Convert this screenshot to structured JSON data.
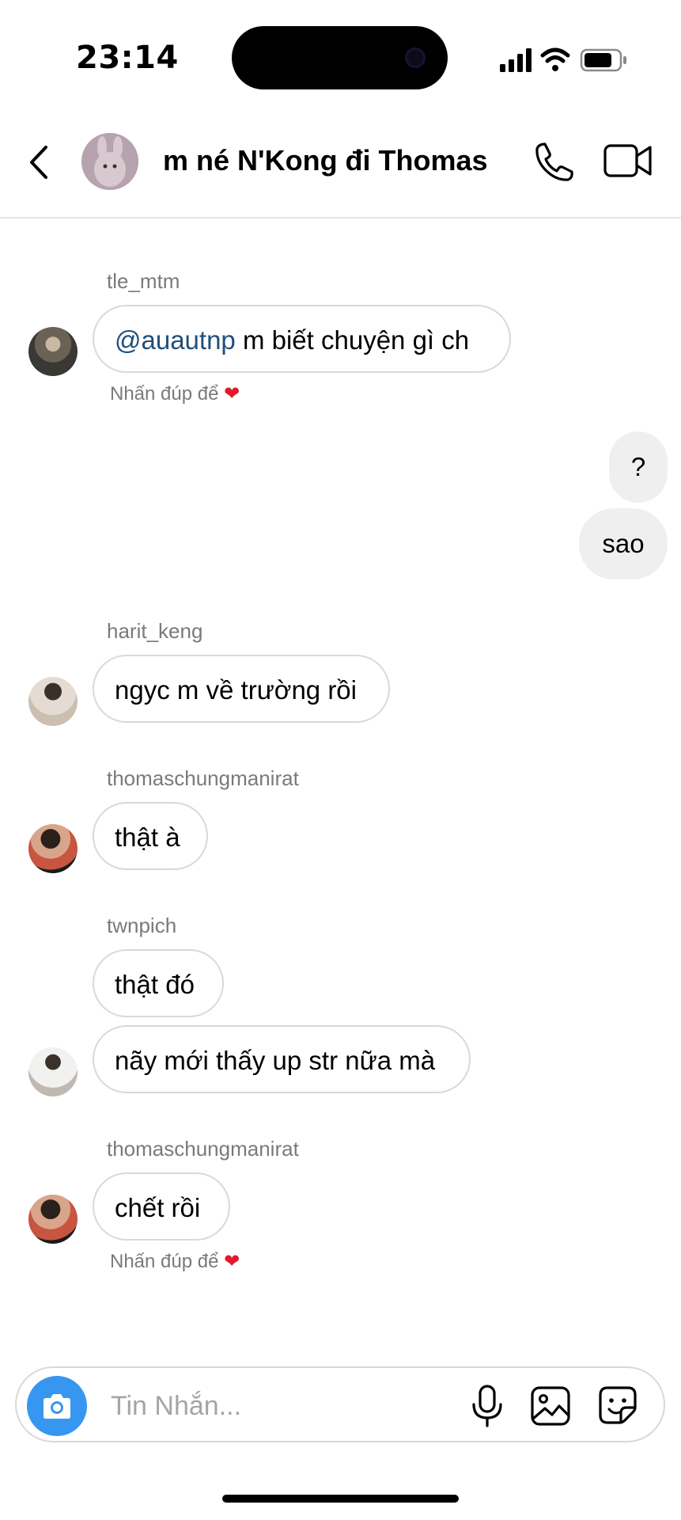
{
  "status_bar": {
    "time": "23:14"
  },
  "header": {
    "title": "m né N'Kong đi Thomas"
  },
  "messages": [
    {
      "sender": "tle_mtm",
      "mention": "@auautnp",
      "text": " m biết chuyện gì ch",
      "hint": "Nhấn đúp để ",
      "heart": "❤"
    },
    {
      "outgoing": [
        "?",
        "sao"
      ]
    },
    {
      "sender": "harit_keng",
      "text": "ngyc m về trường rồi"
    },
    {
      "sender": "thomaschungmanirat",
      "text": "thật à"
    },
    {
      "sender": "twnpich",
      "texts": [
        "thật đó",
        "nãy mới thấy up str nữa mà"
      ]
    },
    {
      "sender": "thomaschungmanirat",
      "text": "chết rồi",
      "hint": "Nhấn đúp để ",
      "heart": "❤"
    }
  ],
  "composer": {
    "placeholder": "Tin Nhắn..."
  },
  "colors": {
    "accent": "#3797f0",
    "mention": "#1f4f7a",
    "heart": "#e0192b"
  }
}
